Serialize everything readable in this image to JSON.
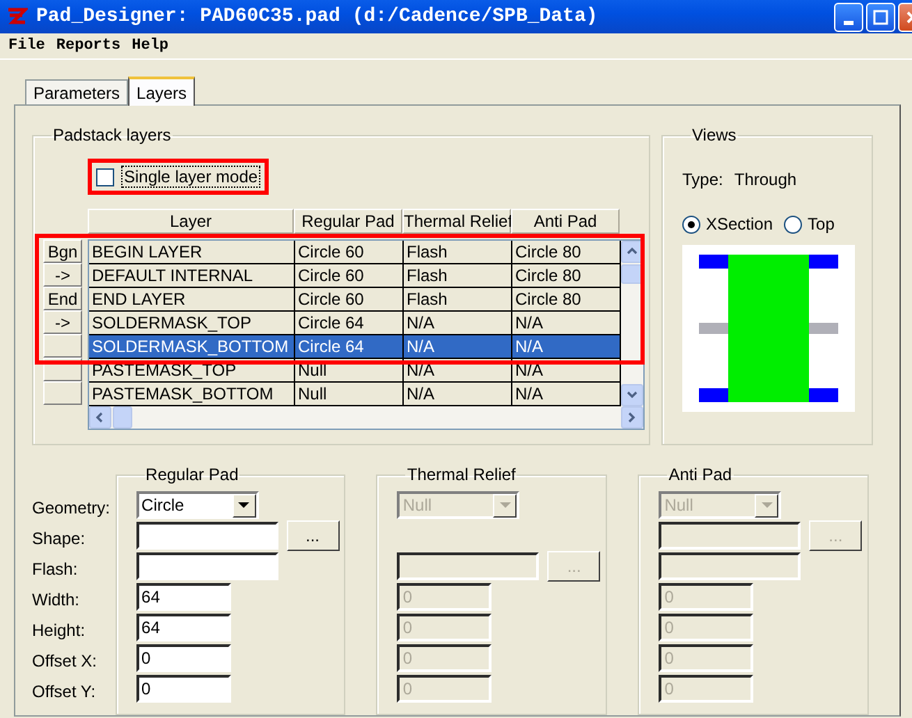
{
  "window": {
    "title": "Pad_Designer: PAD60C35.pad (d:/Cadence/SPB_Data)"
  },
  "menu": [
    "File",
    "Reports",
    "Help"
  ],
  "tabs": [
    {
      "label": "Parameters",
      "selected": false
    },
    {
      "label": "Layers",
      "selected": true
    }
  ],
  "padstack_layers": {
    "title": "Padstack layers",
    "single_layer_mode": {
      "label": "Single layer mode",
      "checked": false,
      "annotated": true
    },
    "columns": [
      "Layer",
      "Regular Pad",
      "Thermal Relief",
      "Anti Pad"
    ],
    "rows": [
      {
        "button": "Bgn",
        "cells": [
          "BEGIN LAYER",
          "Circle 60",
          "Flash",
          "Circle 80"
        ],
        "selected": false,
        "annotated": true
      },
      {
        "button": "->",
        "cells": [
          "DEFAULT INTERNAL",
          "Circle 60",
          "Flash",
          "Circle 80"
        ],
        "selected": false,
        "annotated": true
      },
      {
        "button": "End",
        "cells": [
          "END LAYER",
          "Circle 60",
          "Flash",
          "Circle 80"
        ],
        "selected": false,
        "annotated": true
      },
      {
        "button": "->",
        "cells": [
          "SOLDERMASK_TOP",
          "Circle 64",
          "N/A",
          "N/A"
        ],
        "selected": false,
        "annotated": true
      },
      {
        "cells": [
          "SOLDERMASK_BOTTOM",
          "Circle 64",
          "N/A",
          "N/A"
        ],
        "selected": true,
        "annotated": true
      },
      {
        "cells": [
          "PASTEMASK_TOP",
          "Null",
          "N/A",
          "N/A"
        ],
        "selected": false,
        "annotated": false
      },
      {
        "cells": [
          "PASTEMASK_BOTTOM",
          "Null",
          "N/A",
          "N/A"
        ],
        "selected": false,
        "annotated": false
      }
    ]
  },
  "views": {
    "title": "Views",
    "type_label": "Type:",
    "type_value": "Through",
    "radios": [
      {
        "label": "XSection",
        "selected": true
      },
      {
        "label": "Top",
        "selected": false
      }
    ]
  },
  "field_labels": [
    "Geometry:",
    "Shape:",
    "Flash:",
    "Width:",
    "Height:",
    "Offset X:",
    "Offset Y:"
  ],
  "pad_groups": [
    {
      "title": "Regular Pad",
      "disabled": false,
      "fields": [
        {
          "kind": "dropdown",
          "value": "Circle"
        },
        {
          "kind": "wide",
          "button": "..."
        },
        {
          "kind": "wide"
        },
        {
          "kind": "short",
          "value": "64"
        },
        {
          "kind": "short",
          "value": "64"
        },
        {
          "kind": "short",
          "value": "0"
        },
        {
          "kind": "short",
          "value": "0"
        }
      ]
    },
    {
      "title": "Thermal Relief",
      "disabled": true,
      "fields": [
        {
          "kind": "dropdown",
          "value": "Null"
        },
        {
          "kind": "blank"
        },
        {
          "kind": "wide",
          "button": "..."
        },
        {
          "kind": "short",
          "value": "0"
        },
        {
          "kind": "short",
          "value": "0"
        },
        {
          "kind": "short",
          "value": "0"
        },
        {
          "kind": "short",
          "value": "0"
        }
      ]
    },
    {
      "title": "Anti Pad",
      "disabled": true,
      "fields": [
        {
          "kind": "dropdown",
          "value": "Null"
        },
        {
          "kind": "wide",
          "button": "..."
        },
        {
          "kind": "wide"
        },
        {
          "kind": "short",
          "value": "0"
        },
        {
          "kind": "short",
          "value": "0"
        },
        {
          "kind": "short",
          "value": "0"
        },
        {
          "kind": "short",
          "value": "0"
        }
      ]
    }
  ]
}
